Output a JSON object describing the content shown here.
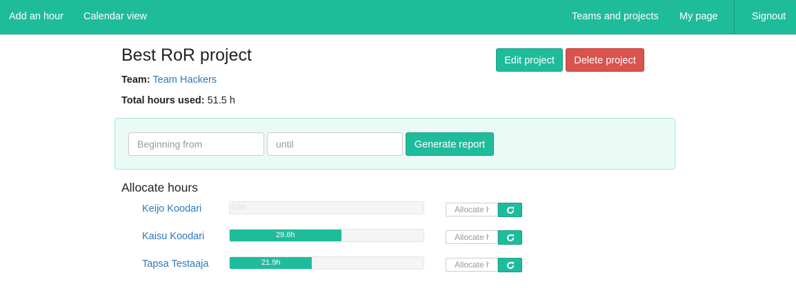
{
  "colors": {
    "accent": "#1fbc9c",
    "danger": "#d9534f",
    "link": "#2a78c0",
    "panel_bg": "#eafbf6"
  },
  "nav": {
    "add_hour": "Add an hour",
    "calendar_view": "Calendar view",
    "teams_projects": "Teams and projects",
    "my_page": "My page",
    "signout": "Signout"
  },
  "project": {
    "title": "Best RoR project",
    "edit_label": "Edit project",
    "delete_label": "Delete project",
    "team_label": "Team:",
    "team_name": "Team Hackers",
    "total_label": "Total hours used:",
    "total_value": "51.5 h"
  },
  "report": {
    "from_placeholder": "Beginning from",
    "until_placeholder": "until",
    "generate_label": "Generate report"
  },
  "allocate": {
    "title": "Allocate hours",
    "input_placeholder": "Allocate hours",
    "refresh_icon": "refresh-icon",
    "members": [
      {
        "name": "Keijo Koodari",
        "hours_label": "0.0h",
        "fraction": 0.0
      },
      {
        "name": "Kaisu Koodari",
        "hours_label": "29.6h",
        "fraction": 0.575
      },
      {
        "name": "Tapsa Testaaja",
        "hours_label": "21.9h",
        "fraction": 0.425
      }
    ]
  }
}
